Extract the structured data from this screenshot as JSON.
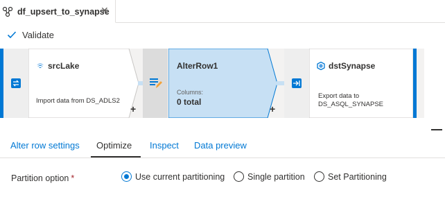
{
  "tab": {
    "title": "df_upsert_to_synapse",
    "close_glyph": "✕",
    "icon": "dataflow-icon"
  },
  "toolbar": {
    "validate_label": "Validate",
    "validate_icon": "checkmark-icon"
  },
  "flow": {
    "source": {
      "title": "srcLake",
      "description": "Import data from DS_ADLS2",
      "icon": "lake-icon"
    },
    "alter": {
      "title": "AlterRow1",
      "columns_label": "Columns:",
      "columns_value": "0 total",
      "icon": "alter-row-icon"
    },
    "sink": {
      "title": "dstSynapse",
      "description_line1": "Export data to",
      "description_line2": "DS_ASQL_SYNAPSE",
      "icon": "synapse-icon"
    },
    "plus_glyph": "+"
  },
  "colors": {
    "accent": "#0078d4",
    "selected_node_fill": "#c7e0f4",
    "canvas": "#f3f2f1"
  },
  "settings_tabs": [
    {
      "label": "Alter row settings",
      "active": false
    },
    {
      "label": "Optimize",
      "active": true
    },
    {
      "label": "Inspect",
      "active": false
    },
    {
      "label": "Data preview",
      "active": false
    }
  ],
  "partition": {
    "label": "Partition option",
    "required_mark": "*",
    "options": [
      {
        "label": "Use current partitioning",
        "selected": true
      },
      {
        "label": "Single partition",
        "selected": false
      },
      {
        "label": "Set Partitioning",
        "selected": false
      }
    ]
  }
}
